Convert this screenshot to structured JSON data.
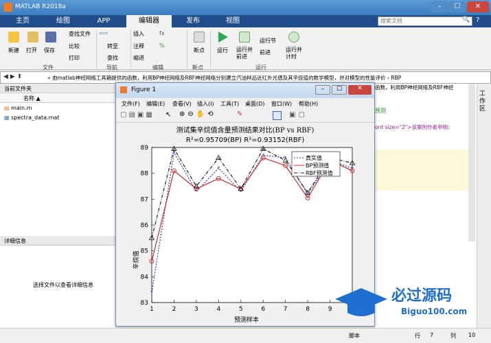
{
  "app_title": "MATLAB R2018a",
  "window_controls": [
    "–",
    "☐",
    "✕"
  ],
  "tabs": [
    "主页",
    "绘图",
    "APP",
    "编辑器",
    "发布",
    "视图"
  ],
  "search_placeholder": "搜索文档",
  "ribbon": {
    "file": {
      "new": "新建",
      "open": "打开",
      "save": "保存",
      "find_files": "查找文件",
      "compare": "比较",
      "print": "打印",
      "section": "文件"
    },
    "nav": {
      "goto": "转至",
      "find": "查找",
      "section": "导航"
    },
    "edit": {
      "insert": "插入",
      "comment": "注释",
      "indent": "缩进",
      "section": "编辑"
    },
    "breakpoints": {
      "label": "断点",
      "section": "断点"
    },
    "run": {
      "run": "运行",
      "run_advance": "运行并\n前进",
      "run_section": "运行节",
      "advance": "前进",
      "run_time": "运行并\n计时",
      "section": "运行"
    }
  },
  "address": "« 由matlab神经网络工具箱提供的函数，利用BP神经网络及RBF神经网络分别建立汽油样品近红外光谱及其辛烷值的数学模型，并对模型的性能评价 › RBP",
  "current_folder": {
    "title": "当前文件夹",
    "col": "名称 ▲",
    "files": [
      "main.m",
      "spectra_data.mat"
    ]
  },
  "details": {
    "title": "详细信息",
    "hint": "选择文件以查看详细信息"
  },
  "editor_text": [
    "函数，利用BP神经网络及RBF神经",
    "预测",
    "ont size=\"2\">该案例作者申明:"
  ],
  "workspace_tab": "工作区",
  "figure": {
    "title": "Figure 1",
    "menus": [
      "文件(F)",
      "编辑(E)",
      "查看(V)",
      "插入(I)",
      "工具(T)",
      "桌面(D)",
      "窗口(W)",
      "帮助(H)"
    ]
  },
  "chart_data": {
    "type": "line",
    "title": "测试集辛烷值含量预测结果对比(BP vs RBF)",
    "subtitle": "R²=0.95709(BP)  R²=0.93152(RBF)",
    "xlabel": "预测样本",
    "ylabel": "辛烷值",
    "x": [
      1,
      2,
      3,
      4,
      5,
      6,
      7,
      8,
      9,
      10
    ],
    "xticks": [
      1,
      2,
      3,
      4,
      5,
      6,
      7,
      8,
      9
    ],
    "yticks": [
      83,
      84,
      85,
      86,
      87,
      88,
      89
    ],
    "xlim": [
      1,
      10
    ],
    "ylim": [
      83,
      89
    ],
    "series": [
      {
        "name": "真实值",
        "color": "#3333cc",
        "values": [
          83.4,
          88.8,
          87.3,
          88.2,
          87.3,
          88.7,
          88.6,
          87.2,
          88.5,
          88.2
        ]
      },
      {
        "name": "BP预测值",
        "color": "#dd2222",
        "values": [
          84.6,
          88.1,
          87.4,
          87.8,
          87.4,
          88.6,
          88.3,
          87.05,
          88.5,
          88.1
        ]
      },
      {
        "name": "RBF预测值",
        "color": "#222222",
        "values": [
          85.5,
          88.95,
          87.5,
          88.6,
          87.4,
          88.95,
          88.5,
          87.25,
          88.6,
          88.4
        ]
      }
    ],
    "legend": "top-right"
  },
  "status": {
    "script": "脚本",
    "row_label": "行",
    "row": "7",
    "col_label": "列",
    "col": "10"
  },
  "watermark": {
    "text": "必过源码",
    "url": "Biguo100.com"
  }
}
